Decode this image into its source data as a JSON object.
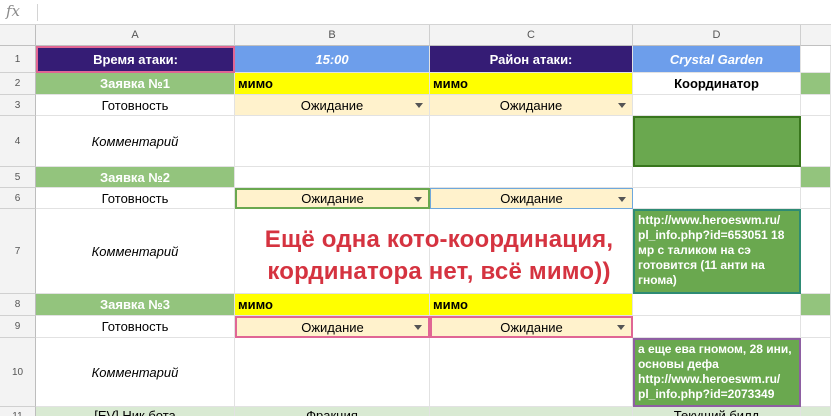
{
  "formula_bar": {
    "fx_label": "fx",
    "content": ""
  },
  "columns": [
    "A",
    "B",
    "C",
    "D"
  ],
  "rows": [
    "1",
    "2",
    "3",
    "4",
    "5",
    "6",
    "7",
    "8",
    "9",
    "10",
    "11"
  ],
  "row1": {
    "a": "Время атаки:",
    "b": "15:00",
    "c": "Район атаки:",
    "d": "Crystal Garden"
  },
  "req1": {
    "title": "Заявка №1",
    "b": "мимо",
    "c": "мимо",
    "d": "Координатор"
  },
  "req2": {
    "title": "Заявка №2"
  },
  "req3": {
    "title": "Заявка №3",
    "b": "мимо",
    "c": "мимо"
  },
  "labels": {
    "readiness": "Готовность",
    "comment": "Комментарий"
  },
  "status_options": {
    "waiting": "Ожидание"
  },
  "d7": "http://www.heroeswm.ru/ pl_info.php?id=653051 18 мр с таликом на сэ готовится (11 анти на гнома)",
  "d10": "а еще ева гномом, 28 ини, основы дефа http://www.heroeswm.ru/ pl_info.php?id=2073349",
  "row11": {
    "a": "[EV] Ник бота",
    "b": "Фракция",
    "d": "Текущий билд"
  },
  "overlay": {
    "line1": "Ещё одна кото-координация,",
    "line2": "кординатора нет, всё мимо))"
  },
  "colors": {
    "header_dark": "#351c75",
    "header_blue": "#6d9eeb",
    "request_green": "#93c47d",
    "yellow": "#ffff00",
    "dropdown_bg": "#fff2cc",
    "comment_green": "#6aa84f",
    "overlay_red": "#d53340"
  }
}
